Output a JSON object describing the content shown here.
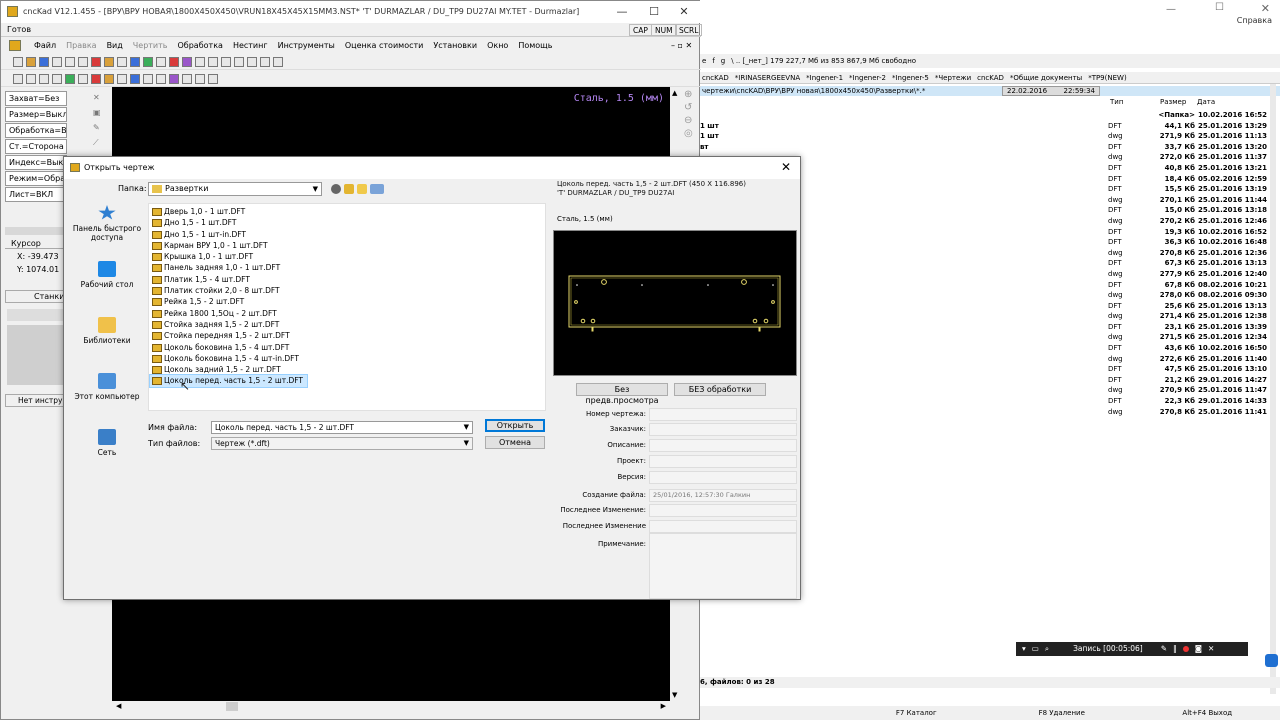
{
  "background_app": {
    "help_label": "Справка",
    "path_bar": "\\  ..  [_нет_]  179 227,7 Мб из 853 867,9 Мб свободно",
    "tabs": [
      "cncKAD",
      "*IRINASERGEEVNA",
      "*Ingener-1",
      "*Ingener-2",
      "*Ingener-5",
      "*Чертежи",
      "cncKAD",
      "*Общие документы",
      "*TP9(NEW)"
    ],
    "dir_path": "чертежи\\cncKAD\\ВРУ\\ВРУ новая\\1800x450x450\\Развертки\\*.*",
    "date": "22.02.2016",
    "time": "22:59:34",
    "columns": {
      "type": "Тип",
      "size": "Размер",
      "date": "Дата"
    },
    "rows": [
      {
        "name": "",
        "type": "",
        "size": "<Папка>",
        "date": "10.02.2016 16:52"
      },
      {
        "name": "1 шт",
        "type": "DFT",
        "size": "44,1 Кб",
        "date": "25.01.2016 13:29"
      },
      {
        "name": "1 шт",
        "type": "dwg",
        "size": "271,9 Кб",
        "date": "25.01.2016 11:13"
      },
      {
        "name": "вт",
        "type": "DFT",
        "size": "33,7 Кб",
        "date": "25.01.2016 13:20"
      },
      {
        "name": "",
        "type": "dwg",
        "size": "272,0 Кб",
        "date": "25.01.2016 11:37"
      },
      {
        "name": "",
        "type": "DFT",
        "size": "40,8 Кб",
        "date": "25.01.2016 13:21"
      },
      {
        "name": "",
        "type": "DFT",
        "size": "18,4 Кб",
        "date": "05.02.2016 12:59"
      },
      {
        "name": "",
        "type": "DFT",
        "size": "15,5 Кб",
        "date": "25.01.2016 13:19"
      },
      {
        "name": "",
        "type": "dwg",
        "size": "270,1 Кб",
        "date": "25.01.2016 11:44"
      },
      {
        "name": "",
        "type": "DFT",
        "size": "15,0 Кб",
        "date": "25.01.2016 13:18"
      },
      {
        "name": "",
        "type": "dwg",
        "size": "270,2 Кб",
        "date": "25.01.2016 12:46"
      },
      {
        "name": "",
        "type": "DFT",
        "size": "19,3 Кб",
        "date": "10.02.2016 16:52"
      },
      {
        "name": "",
        "type": "DFT",
        "size": "36,3 Кб",
        "date": "10.02.2016 16:48"
      },
      {
        "name": "",
        "type": "dwg",
        "size": "270,8 Кб",
        "date": "25.01.2016 12:36"
      },
      {
        "name": "",
        "type": "DFT",
        "size": "67,3 Кб",
        "date": "25.01.2016 13:13"
      },
      {
        "name": "",
        "type": "dwg",
        "size": "277,9 Кб",
        "date": "25.01.2016 12:40"
      },
      {
        "name": "",
        "type": "DFT",
        "size": "67,8 Кб",
        "date": "08.02.2016 10:21"
      },
      {
        "name": "",
        "type": "dwg",
        "size": "278,0 Кб",
        "date": "08.02.2016 09:30"
      },
      {
        "name": "",
        "type": "DFT",
        "size": "25,6 Кб",
        "date": "25.01.2016 13:13"
      },
      {
        "name": "",
        "type": "dwg",
        "size": "271,4 Кб",
        "date": "25.01.2016 12:38"
      },
      {
        "name": "",
        "type": "DFT",
        "size": "23,1 Кб",
        "date": "25.01.2016 13:39"
      },
      {
        "name": "",
        "type": "dwg",
        "size": "271,5 Кб",
        "date": "25.01.2016 12:34"
      },
      {
        "name": "",
        "type": "DFT",
        "size": "43,6 Кб",
        "date": "10.02.2016 16:50"
      },
      {
        "name": "",
        "type": "dwg",
        "size": "272,6 Кб",
        "date": "25.01.2016 11:40"
      },
      {
        "name": "",
        "type": "DFT",
        "size": "47,5 Кб",
        "date": "25.01.2016 13:10"
      },
      {
        "name": "",
        "type": "DFT",
        "size": "21,2 Кб",
        "date": "29.01.2016 14:27"
      },
      {
        "name": "",
        "type": "dwg",
        "size": "270,9 Кб",
        "date": "25.01.2016 11:47"
      },
      {
        "name": "",
        "type": "DFT",
        "size": "22,3 Кб",
        "date": "29.01.2016 14:33"
      },
      {
        "name": "",
        "type": "dwg",
        "size": "270,8 Кб",
        "date": "25.01.2016 11:41"
      }
    ],
    "status": "6, файлов: 0 из 28",
    "fkeys": [
      "F7 Каталог",
      "F8 Удаление",
      "Alt+F4 Выход"
    ]
  },
  "main_window": {
    "title": "cncKad V12.1.455 - [ВРУ\\ВРУ НОВАЯ\\1800X450X450\\VRUN18X45X45X15MM3.NST*  'T'  DURMAZLAR / DU_TP9   DU27AI  MY.TET - Durmazlar]",
    "ready": "Готов",
    "indicators": [
      "CAP",
      "NUM",
      "SCRL"
    ],
    "menu": [
      {
        "label": "Файл",
        "disabled": false
      },
      {
        "label": "Правка",
        "disabled": true
      },
      {
        "label": "Вид",
        "disabled": false
      },
      {
        "label": "Чертить",
        "disabled": true
      },
      {
        "label": "Обработка",
        "disabled": false
      },
      {
        "label": "Нестинг",
        "disabled": false
      },
      {
        "label": "Инструменты",
        "disabled": false
      },
      {
        "label": "Оценка стоимости",
        "disabled": false
      },
      {
        "label": "Установки",
        "disabled": false
      },
      {
        "label": "Окно",
        "disabled": false
      },
      {
        "label": "Помощь",
        "disabled": false
      }
    ],
    "left_panel": [
      "Захват=Без",
      "Размер=Выкл.",
      "Обработка=Выкл",
      "Ст.=Сторона",
      "Индекс=Выкл.",
      "Режим=Обраб",
      "Лист=ВКЛ"
    ],
    "cursor_label": "Курсор",
    "cursor_x_label": "X:",
    "cursor_x": "-39.473",
    "cursor_y_label": "Y:",
    "cursor_y": "1074.01",
    "machines_label": "Станки",
    "no_tool": "Нет инструм",
    "material": "Сталь, 1.5 (мм)"
  },
  "dialog": {
    "title": "Открыть чертеж",
    "folder_label": "Папка:",
    "folder": "Развертки",
    "places": [
      "Панель быстрого доступа",
      "Рабочий стол",
      "Библиотеки",
      "Этот компьютер",
      "Сеть"
    ],
    "files": [
      "Дверь 1,0 - 1 шт.DFT",
      "Дно 1,5 - 1 шт.DFT",
      "Дно 1,5 - 1 шт-in.DFT",
      "Карман  ВРУ 1,0 - 1 шт.DFT",
      "Крышка 1,0 - 1 шт.DFT",
      "Панель задняя 1,0 - 1 шт.DFT",
      "Платик 1,5 - 4 шт.DFT",
      "Платик стойки 2,0 - 8 шт.DFT",
      "Рейка 1,5 - 2 шт.DFT",
      "Рейка 1800 1,5Оц - 2 шт.DFT",
      "Стойка задняя 1,5 - 2 шт.DFT",
      "Стойка передняя 1,5 - 2 шт.DFT",
      "Цоколь боковина 1,5 - 4 шт.DFT",
      "Цоколь боковина 1,5 - 4 шт-in.DFT",
      "Цоколь задний 1,5 - 2 шт.DFT",
      "Цоколь перед. часть 1,5 - 2 шт.DFT"
    ],
    "selected_index": 15,
    "filename_label": "Имя файла:",
    "filename": "Цоколь перед. часть 1,5 - 2 шт.DFT",
    "filetype_label": "Тип файлов:",
    "filetype": "Чертеж (*.dft)",
    "open_button": "Открыть",
    "cancel_button": "Отмена",
    "preview_info_line1": "Цоколь перед. часть 1,5 - 2 шт.DFT      (450 X 116.896)",
    "preview_info_line2": "'T' DURMAZLAR / DU_TP9    DU27AI",
    "preview_material": "Сталь, 1.5 (мм)",
    "btn_no_preview": "Без предв.просмотра",
    "btn_no_processing": "БЕЗ обработки",
    "props": [
      {
        "label": "Номер чертежа:",
        "value": ""
      },
      {
        "label": "Заказчик:",
        "value": ""
      },
      {
        "label": "Описание:",
        "value": ""
      },
      {
        "label": "Проект:",
        "value": ""
      },
      {
        "label": "Версия:",
        "value": ""
      },
      {
        "label": "Создание файла:",
        "value": "25/01/2016, 12:57:30  Галкин"
      },
      {
        "label": "Последнее Изменение:",
        "value": ""
      },
      {
        "label": "Последнее Изменение",
        "value": ""
      },
      {
        "label": "Примечание:",
        "value": ""
      }
    ]
  },
  "recorder": {
    "label": "Запись [00:05:06]"
  }
}
